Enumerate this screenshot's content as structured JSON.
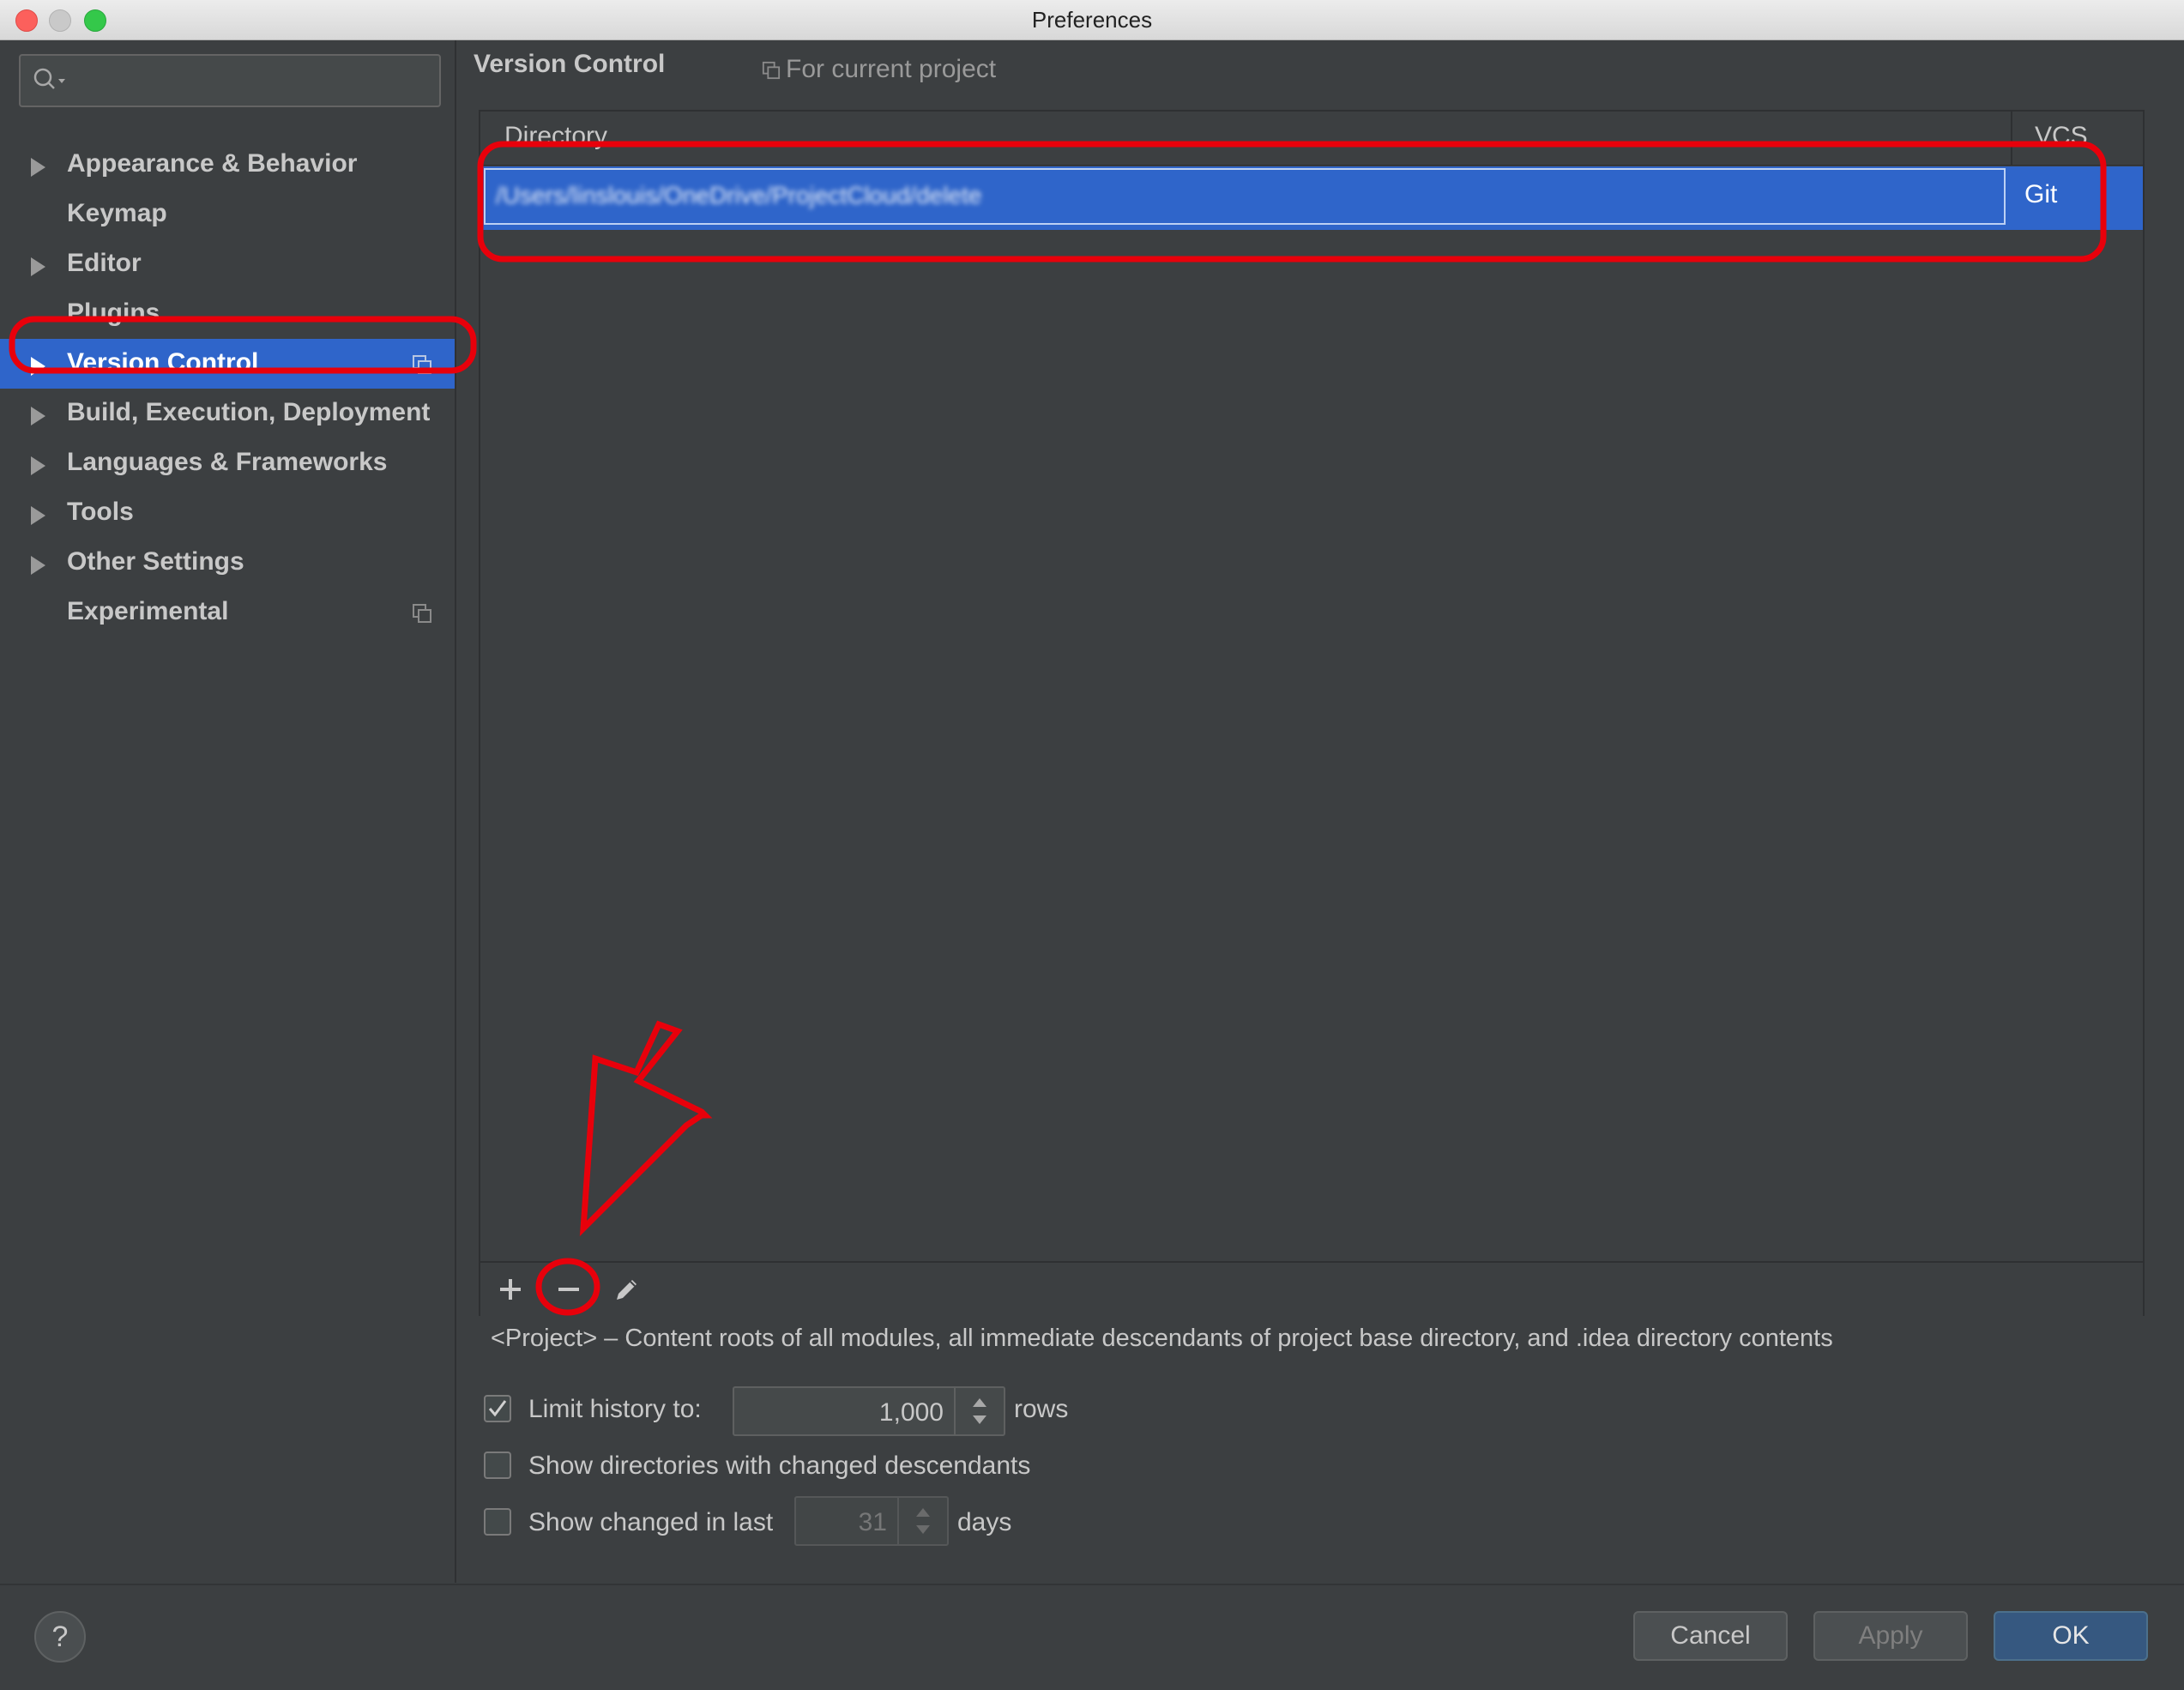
{
  "window": {
    "title": "Preferences"
  },
  "sidebar": {
    "search_placeholder": "",
    "items": [
      {
        "label": "Appearance & Behavior",
        "expandable": true
      },
      {
        "label": "Keymap",
        "expandable": false
      },
      {
        "label": "Editor",
        "expandable": true
      },
      {
        "label": "Plugins",
        "expandable": false
      },
      {
        "label": "Version Control",
        "expandable": true,
        "selected": true
      },
      {
        "label": "Build, Execution, Deployment",
        "expandable": true
      },
      {
        "label": "Languages & Frameworks",
        "expandable": true
      },
      {
        "label": "Tools",
        "expandable": true
      },
      {
        "label": "Other Settings",
        "expandable": true
      },
      {
        "label": "Experimental",
        "expandable": false
      }
    ]
  },
  "main": {
    "title": "Version Control",
    "scope": "For current project",
    "table": {
      "columns": [
        "Directory",
        "VCS"
      ],
      "rows": [
        {
          "directory": "/Users/linslouis/OneDrive/ProjectCloud/delete",
          "vcs": "Git"
        }
      ]
    },
    "info": "<Project> – Content roots of all modules, all immediate descendants of project base directory, and .idea directory contents",
    "options": {
      "limit_history": {
        "label": "Limit history to:",
        "checked": true,
        "value": "1,000",
        "suffix": "rows"
      },
      "show_dirs": {
        "label": "Show directories with changed descendants",
        "checked": false
      },
      "show_changed": {
        "label": "Show changed in last",
        "checked": false,
        "value": "31",
        "suffix": "days"
      }
    }
  },
  "buttons": {
    "help": "?",
    "cancel": "Cancel",
    "apply": "Apply",
    "ok": "OK"
  },
  "colors": {
    "selection": "#2f65ca",
    "annotation": "#e8000b",
    "background": "#3c3f41"
  }
}
